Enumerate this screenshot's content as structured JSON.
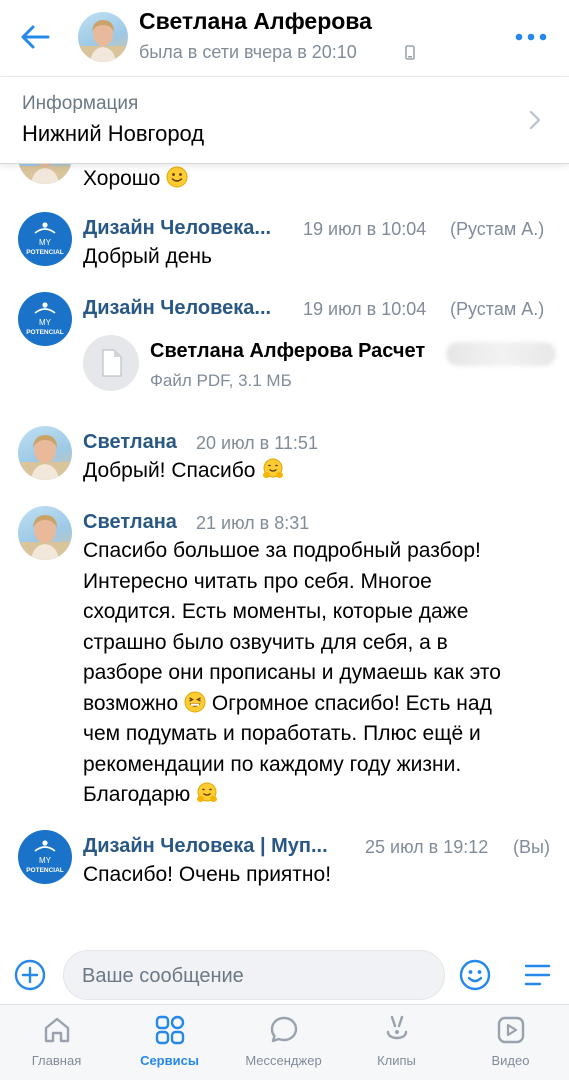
{
  "header": {
    "name": "Светлана Алферова",
    "status": "была в сети вчера в 20:10",
    "back_icon": "arrow-left-icon",
    "more_icon": "more-horizontal-icon"
  },
  "info": {
    "label": "Информация",
    "value": "Нижний Новгород"
  },
  "messages": [
    {
      "text": "Хорошо",
      "emoji": "slightly-smiling-face"
    },
    {
      "sender": "Дизайн Человека...",
      "time": "19 июл в 10:04",
      "tag": "(Рустам А.)",
      "text": "Добрый день"
    },
    {
      "sender": "Дизайн Человека...",
      "time": "19 июл в 10:04",
      "tag": "(Рустам А.)",
      "file": {
        "name": "Светлана Алферова Расчет",
        "meta": "Файл PDF, 3.1 МБ"
      }
    },
    {
      "sender": "Светлана",
      "time": "20 июл в 11:51",
      "text": "Добрый! Спасибо",
      "emoji": "hugging-face"
    },
    {
      "sender": "Светлана",
      "time": "21 июл в 8:31",
      "lines": [
        "Спасибо большое за подробный разбор!",
        "Интересно читать про себя. Многое",
        "сходится. Есть моменты, которые даже",
        "страшно было озвучить для себя, а в",
        "разборе они прописаны и думаешь как это",
        "возможно",
        "Огромное спасибо! Есть над",
        "чем подумать и поработать. Плюс ещё и",
        "рекомендации по каждому году жизни.",
        "Благодарю"
      ]
    },
    {
      "sender": "Дизайн Человека | Myп...",
      "time": "25 июл в 19:12",
      "tag": "(Вы)",
      "text": "Спасибо! Очень приятно!"
    }
  ],
  "brand_avatar": {
    "line1": "MY",
    "line2": "POTENCIAL"
  },
  "composer": {
    "placeholder": "Ваше сообщение"
  },
  "tabs": [
    {
      "label": "Главная",
      "icon": "home-icon"
    },
    {
      "label": "Сервисы",
      "icon": "services-icon",
      "active": true
    },
    {
      "label": "Мессенджер",
      "icon": "messenger-icon"
    },
    {
      "label": "Клипы",
      "icon": "clips-icon"
    },
    {
      "label": "Видео",
      "icon": "video-icon"
    }
  ],
  "colors": {
    "accent": "#2688eb",
    "link": "#2a5885",
    "secondary": "#818c99",
    "brand_avatar": "#1a73c8"
  }
}
